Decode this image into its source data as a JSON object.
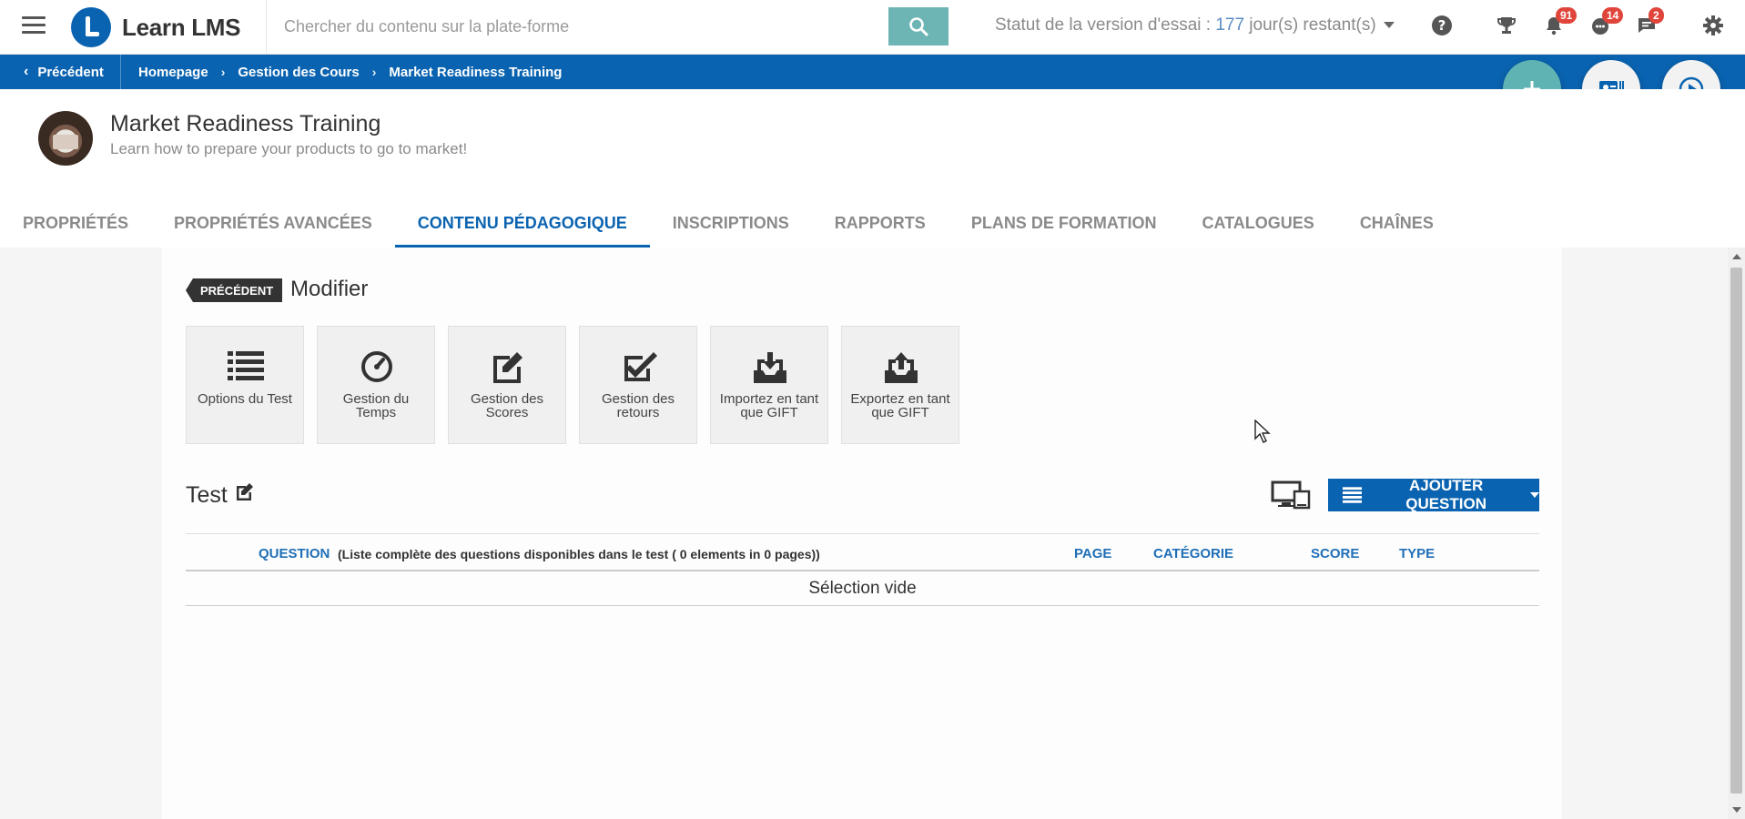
{
  "topbar": {
    "logo_text": "Learn LMS",
    "search_placeholder": "Chercher du contenu sur la plate-forme",
    "trial_prefix": "Statut de la version d'essai : ",
    "trial_days": "177",
    "trial_suffix": " jour(s) restant(s)",
    "badges": {
      "notifications": "91",
      "chat": "14",
      "messages": "2"
    },
    "icons": [
      "menu-icon",
      "search-icon",
      "help-icon",
      "trophy-icon",
      "bell-icon",
      "chat-icon",
      "message-icon",
      "gear-icon"
    ]
  },
  "breadcrumb": {
    "back_label": "Précédent",
    "items": [
      "Homepage",
      "Gestion des Cours",
      "Market Readiness Training"
    ]
  },
  "course": {
    "title": "Market Readiness Training",
    "subtitle": "Learn how to prepare your products to go to market!"
  },
  "tabs": [
    {
      "label": "Propriétés",
      "active": false
    },
    {
      "label": "Propriétés avancées",
      "active": false
    },
    {
      "label": "Contenu pédagogique",
      "active": true
    },
    {
      "label": "Inscriptions",
      "active": false
    },
    {
      "label": "Rapports",
      "active": false
    },
    {
      "label": "Plans de formation",
      "active": false
    },
    {
      "label": "Catalogues",
      "active": false
    },
    {
      "label": "Chaînes",
      "active": false
    }
  ],
  "editor": {
    "prev_tag": "PRÉCÉDENT",
    "heading": "Modifier",
    "tools": [
      {
        "label": "Options du Test",
        "icon": "list-icon"
      },
      {
        "label": "Gestion du Temps",
        "icon": "gauge-icon"
      },
      {
        "label": "Gestion des Scores",
        "icon": "edit-icon"
      },
      {
        "label": "Gestion des retours",
        "icon": "checkbox-icon"
      },
      {
        "label": "Importez en tant que GIFT",
        "icon": "inbox-download-icon"
      },
      {
        "label": "Exportez en tant que GIFT",
        "icon": "inbox-upload-icon"
      }
    ],
    "test_title": "Test",
    "add_question_label": "AJOUTER QUESTION"
  },
  "table": {
    "columns": {
      "question": "QUESTION",
      "page": "PAGE",
      "category": "CATÉGORIE",
      "score": "SCORE",
      "type": "TYPE"
    },
    "note": "(Liste complète des questions disponibles dans le test ( 0 elements in 0 pages))",
    "empty": "Sélection vide"
  },
  "colors": {
    "primary": "#0a63b0",
    "accent": "#5fb3b3",
    "badge": "#e0453b"
  }
}
